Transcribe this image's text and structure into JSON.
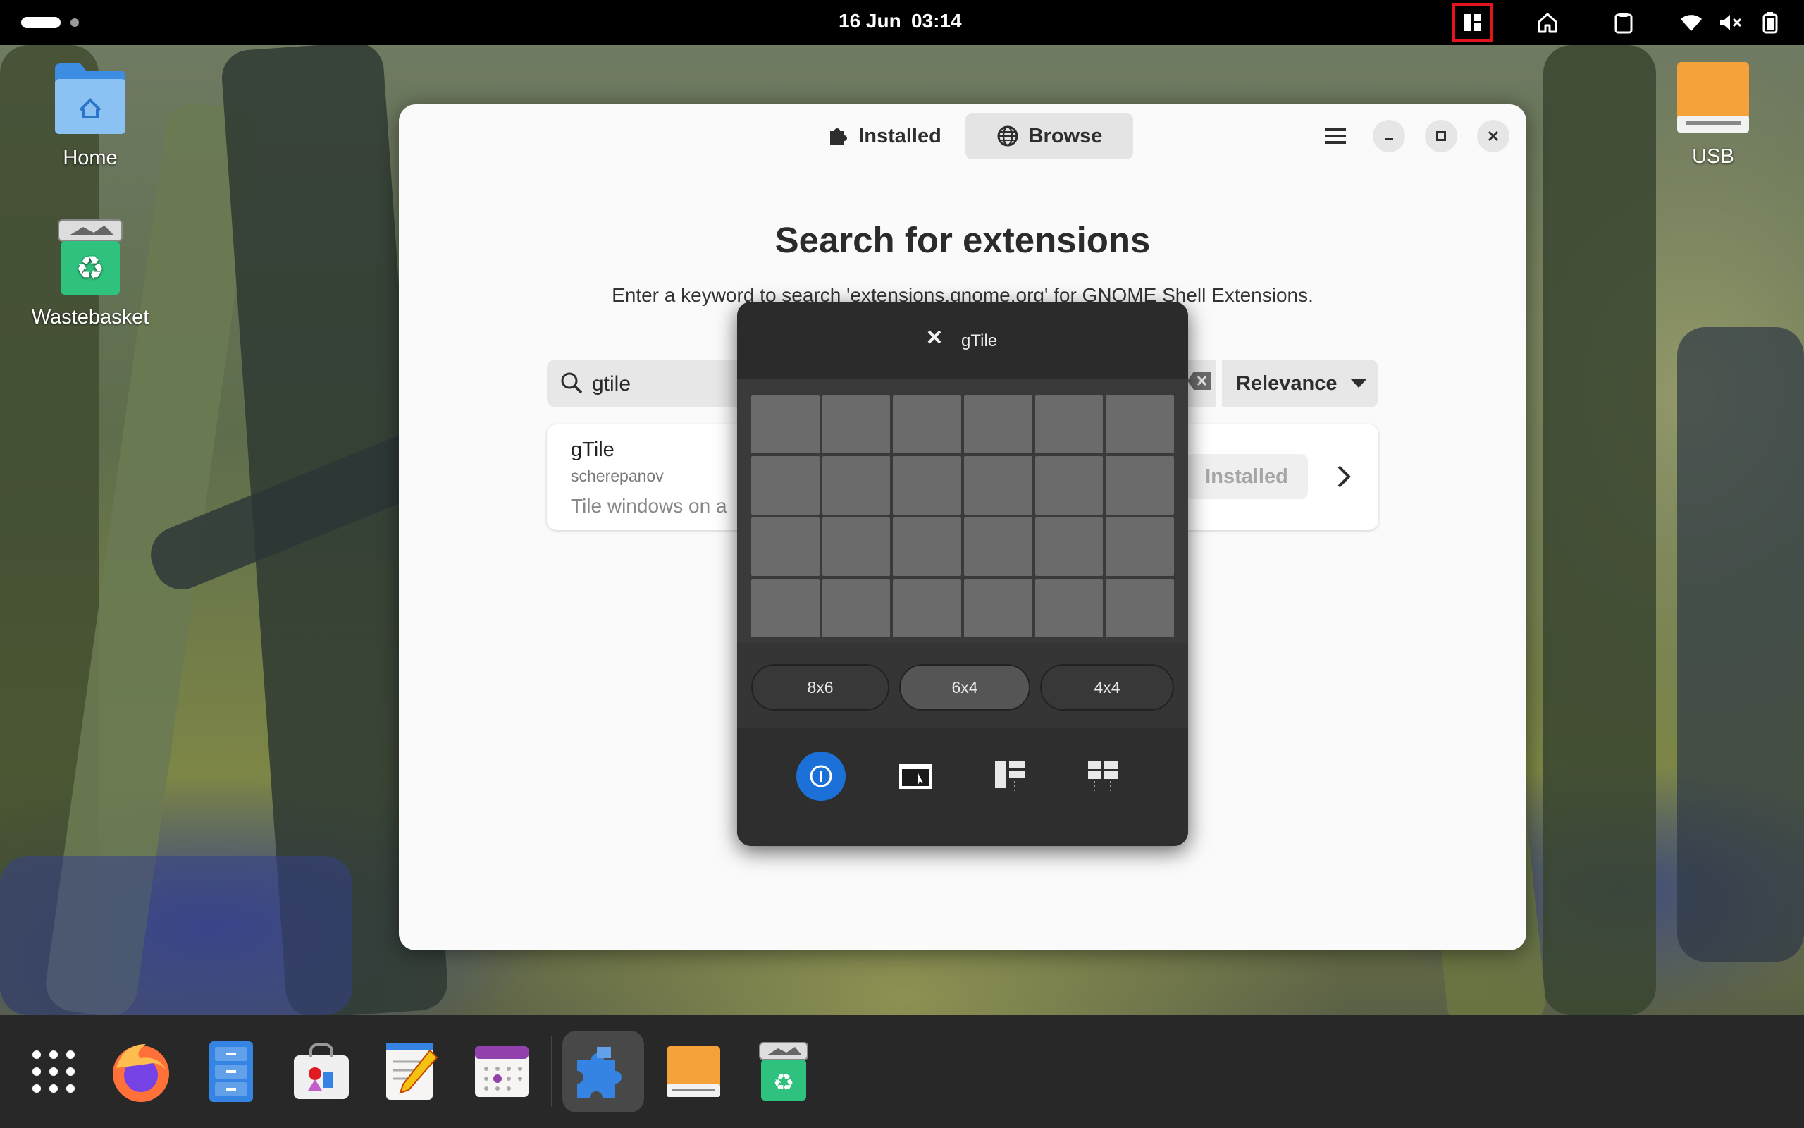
{
  "topbar": {
    "date": "16 Jun",
    "time": "03:14",
    "tray_icons": [
      "gtile-layout-icon",
      "home-icon",
      "clipboard-icon",
      "wifi-icon",
      "volume-muted-icon",
      "battery-icon"
    ]
  },
  "desktop": {
    "icons": [
      {
        "label": "Home",
        "icon": "home-folder-icon"
      },
      {
        "label": "Wastebasket",
        "icon": "wastebasket-icon"
      },
      {
        "label": "USB",
        "icon": "usb-drive-icon"
      }
    ]
  },
  "window": {
    "tabs": [
      {
        "label": "Installed",
        "icon": "puzzle-icon"
      },
      {
        "label": "Browse",
        "icon": "globe-icon",
        "selected": true
      }
    ],
    "title": "Search for extensions",
    "subtitle": "Enter a keyword to search 'extensions.gnome.org' for GNOME Shell Extensions.",
    "search": {
      "value": "gtile",
      "placeholder": ""
    },
    "sort": {
      "selected": "Relevance"
    },
    "result": {
      "name": "gTile",
      "author": "scherepanov",
      "description": "Tile windows on a",
      "button": "Installed"
    }
  },
  "gtile": {
    "title": "gTile",
    "grid": {
      "columns": 6,
      "rows": 4
    },
    "presets": [
      "8x6",
      "6x4",
      "4x4"
    ],
    "active_preset": "6x4",
    "actions": [
      "info-icon",
      "window-select-icon",
      "auto-tile-main-icon",
      "auto-tile-columns-icon"
    ]
  },
  "dock": {
    "items": [
      "app-grid-icon",
      "firefox-icon",
      "files-icon",
      "software-icon",
      "text-editor-icon",
      "calendar-icon",
      "extensions-icon",
      "usb-drive-icon",
      "wastebasket-icon"
    ],
    "active": "extensions-icon"
  },
  "colors": {
    "accent": "#1c71d8",
    "highlight": "#e3141b",
    "usb": "#f6a23a",
    "wastebasket": "#26a269"
  }
}
